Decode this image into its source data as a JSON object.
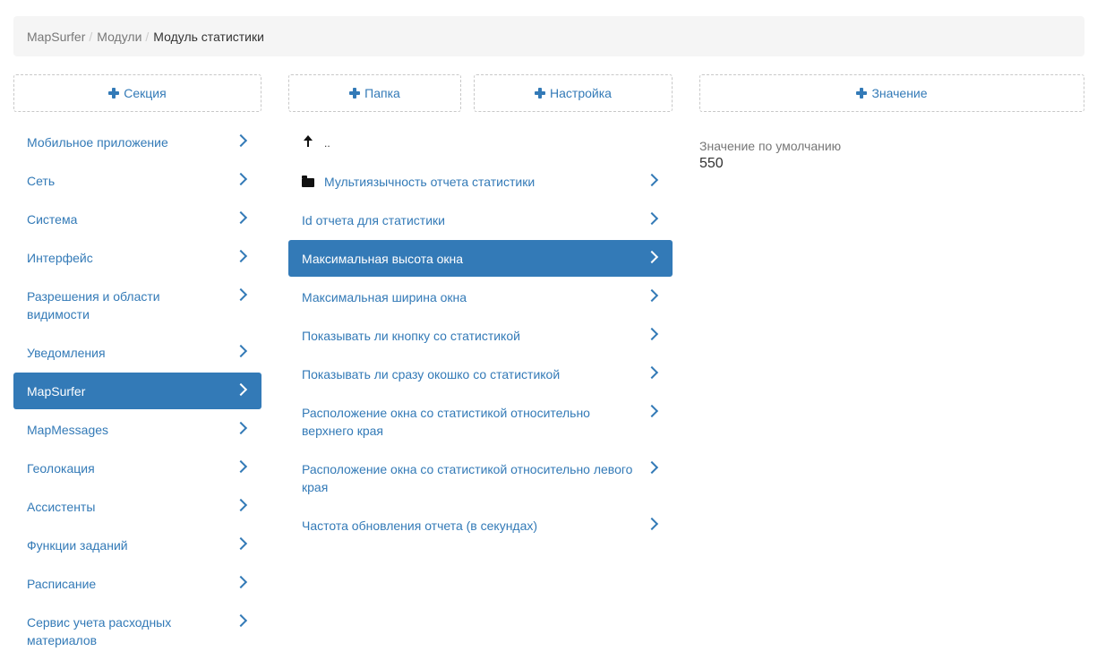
{
  "breadcrumb": [
    {
      "label": "MapSurfer"
    },
    {
      "label": "Модули"
    },
    {
      "label": "Модуль статистики"
    }
  ],
  "buttons": {
    "section": "Секция",
    "folder": "Папка",
    "setting": "Настройка",
    "value": "Значение"
  },
  "sections": [
    {
      "label": "Мобильное приложение"
    },
    {
      "label": "Сеть"
    },
    {
      "label": "Система"
    },
    {
      "label": "Интерфейс"
    },
    {
      "label": "Разрешения и области видимости"
    },
    {
      "label": "Уведомления"
    },
    {
      "label": "MapSurfer",
      "active": true
    },
    {
      "label": "MapMessages"
    },
    {
      "label": "Геолокация"
    },
    {
      "label": "Ассистенты"
    },
    {
      "label": "Функции заданий"
    },
    {
      "label": "Расписание"
    },
    {
      "label": "Сервис учета расходных материалов"
    }
  ],
  "settings": {
    "up_label": "..",
    "items": [
      {
        "label": "Мультиязычность отчета статистики",
        "icon": "folder-icon"
      },
      {
        "label": "Id отчета для статистики"
      },
      {
        "label": "Максимальная высота окна",
        "active": true
      },
      {
        "label": "Максимальная ширина окна"
      },
      {
        "label": "Показывать ли кнопку со статистикой"
      },
      {
        "label": "Показывать ли сразу окошко со статистикой"
      },
      {
        "label": "Расположение окна со статистикой относительно верхнего края"
      },
      {
        "label": "Расположение окна со статистикой относительно левого края"
      },
      {
        "label": "Частота обновления отчета (в секундах)"
      }
    ]
  },
  "value_panel": {
    "label": "Значение по умолчанию",
    "value": "550"
  }
}
